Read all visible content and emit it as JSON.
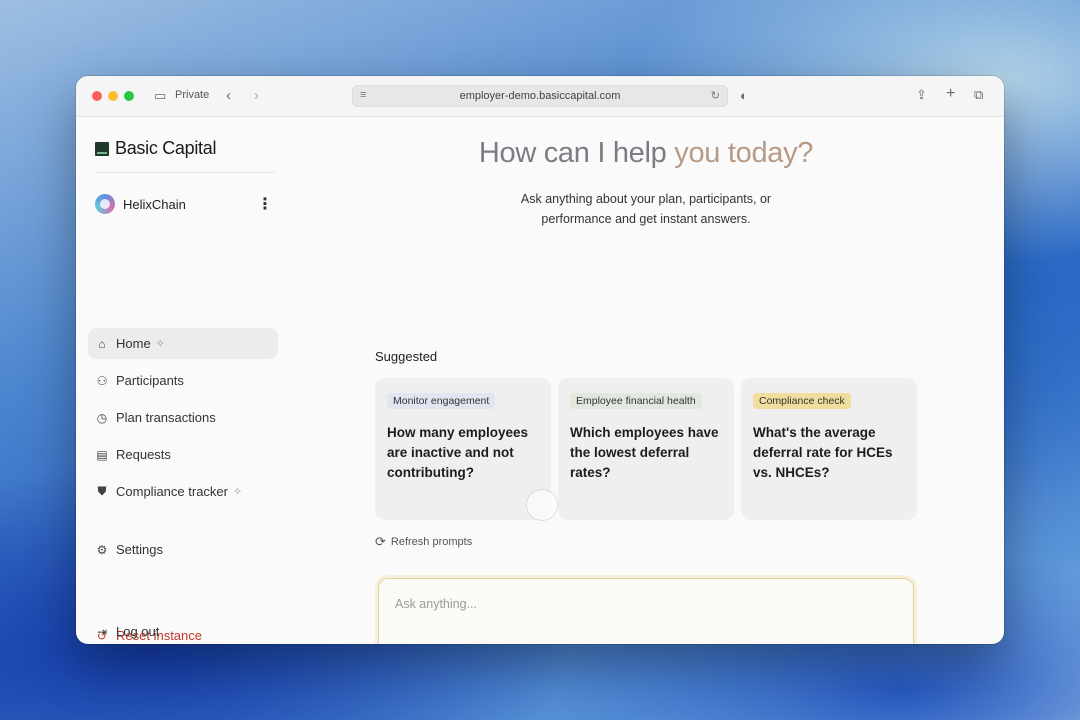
{
  "browser": {
    "private_label": "Private",
    "url": "employer-demo.basiccapital.com"
  },
  "sidebar": {
    "brand": "Basic Capital",
    "org_name": "HelixChain",
    "items": [
      {
        "label": "Home",
        "icon": "home-icon",
        "active": true,
        "sparkle": true
      },
      {
        "label": "Participants",
        "icon": "users-icon"
      },
      {
        "label": "Plan transactions",
        "icon": "clock-icon"
      },
      {
        "label": "Requests",
        "icon": "document-icon"
      },
      {
        "label": "Compliance tracker",
        "icon": "shield-icon",
        "sparkle": true
      },
      {
        "label": "Settings",
        "icon": "gear-icon"
      }
    ],
    "reset_label": "Reset instance",
    "logout_label": "Log out"
  },
  "main": {
    "headline_part1": "How can I help ",
    "headline_part2": "you today?",
    "subtitle": "Ask anything about your plan, participants, or performance and get instant answers.",
    "suggested_label": "Suggested",
    "cards": [
      {
        "tag": "Monitor engagement",
        "question": "How many employees are inactive and not contributing?"
      },
      {
        "tag": "Employee financial health",
        "question": "Which employees have the lowest deferral rates?"
      },
      {
        "tag": "Compliance check",
        "question": "What's the average deferral rate for HCEs vs. NHCEs?"
      }
    ],
    "refresh_label": "Refresh prompts",
    "composer_placeholder": "Ask anything..."
  },
  "colors": {
    "headline_grey": "#7a7d85",
    "headline_warm": "#b79a86",
    "danger": "#c0392b",
    "compliance_tag": "#f1dd9e"
  }
}
